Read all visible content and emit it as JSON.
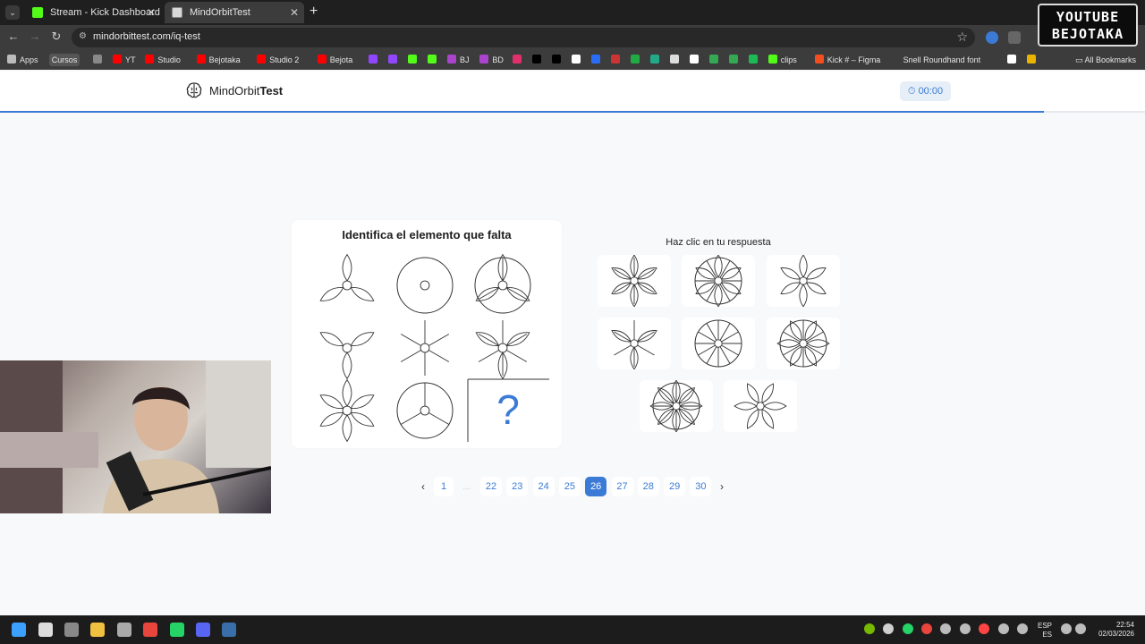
{
  "browser": {
    "tabs": [
      {
        "title": "Stream - Kick Dashboard",
        "favicon_color": "#53fc18"
      },
      {
        "title": "MindOrbitTest",
        "favicon_color": "#d8d8d8"
      }
    ],
    "url": "mindorbittest.com/iq-test",
    "bookmarks": [
      {
        "label": "Apps",
        "icon": "apps-grid-icon",
        "color": "#bbbbbb"
      },
      {
        "label": "Cursos",
        "icon": "",
        "color": "#555555"
      },
      {
        "label": "",
        "icon": "grid-icon",
        "color": "#888888"
      },
      {
        "label": "YT",
        "icon": "youtube-icon",
        "color": "#ff0000"
      },
      {
        "label": "Studio",
        "icon": "youtube-icon",
        "color": "#ff0000"
      },
      {
        "label": "Bejotaka",
        "icon": "youtube-icon",
        "color": "#ff0000"
      },
      {
        "label": "Studio 2",
        "icon": "youtube-icon",
        "color": "#ff0000"
      },
      {
        "label": "Bejota",
        "icon": "youtube-icon",
        "color": "#ff0000"
      },
      {
        "label": "",
        "icon": "twitch-icon",
        "color": "#9146ff"
      },
      {
        "label": "",
        "icon": "twitch-icon",
        "color": "#9146ff"
      },
      {
        "label": "",
        "icon": "kick-icon",
        "color": "#53fc18"
      },
      {
        "label": "",
        "icon": "kick-icon",
        "color": "#53fc18"
      },
      {
        "label": "BJ",
        "icon": "bj-icon",
        "color": "#aa44cc"
      },
      {
        "label": "BD",
        "icon": "bd-icon",
        "color": "#aa44cc"
      },
      {
        "label": "",
        "icon": "instagram-icon",
        "color": "#e1306c"
      },
      {
        "label": "",
        "icon": "tiktok-icon",
        "color": "#000000"
      },
      {
        "label": "",
        "icon": "x-icon",
        "color": "#000000"
      },
      {
        "label": "",
        "icon": "f-icon",
        "color": "#ffffff"
      },
      {
        "label": "",
        "icon": "messenger-icon",
        "color": "#2a6df4"
      },
      {
        "label": "",
        "icon": "pen-icon",
        "color": "#cc3333"
      },
      {
        "label": "",
        "icon": "cube-icon",
        "color": "#22aa44"
      },
      {
        "label": "",
        "icon": "photo-icon",
        "color": "#22aa88"
      },
      {
        "label": "",
        "icon": "grid-icon",
        "color": "#dddddd"
      },
      {
        "label": "",
        "icon": "notion-icon",
        "color": "#ffffff"
      },
      {
        "label": "",
        "icon": "drive-icon",
        "color": "#34a853"
      },
      {
        "label": "",
        "icon": "drive-icon",
        "color": "#34a853"
      },
      {
        "label": "",
        "icon": "spotify-icon",
        "color": "#1db954"
      },
      {
        "label": "clips",
        "icon": "clips-icon",
        "color": "#53fc18"
      },
      {
        "label": "Kick # – Figma",
        "icon": "figma-icon",
        "color": "#f24e1e"
      },
      {
        "label": "Snell Roundhand font",
        "icon": "",
        "color": "#777777"
      },
      {
        "label": "",
        "icon": "c-icon",
        "color": "#ffffff"
      },
      {
        "label": "",
        "icon": "bookmark-icon",
        "color": "#e8b400"
      }
    ],
    "all_bookmarks": "All Bookmarks",
    "overlay_badge": [
      "YOUTUBE",
      "BEJOTAKA"
    ]
  },
  "site": {
    "brand_regular": "MindOrbit",
    "brand_bold": "Test",
    "timer": "00:00",
    "progress_fraction": 0.912,
    "accent": "#3b7bd6"
  },
  "puzzle": {
    "title": "Identifica el elemento que falta",
    "missing_mark": "?"
  },
  "answers": {
    "title": "Haz clic en tu respuesta"
  },
  "pagination": {
    "first": "1",
    "ellipsis": "...",
    "pages": [
      "22",
      "23",
      "24",
      "25",
      "26",
      "27",
      "28",
      "29",
      "30"
    ],
    "current": "26",
    "prev": "‹",
    "next": "›"
  },
  "taskbar": {
    "lang_line1": "ESP",
    "lang_line2": "ES",
    "time": "22:54",
    "date": "02/03/2026"
  }
}
